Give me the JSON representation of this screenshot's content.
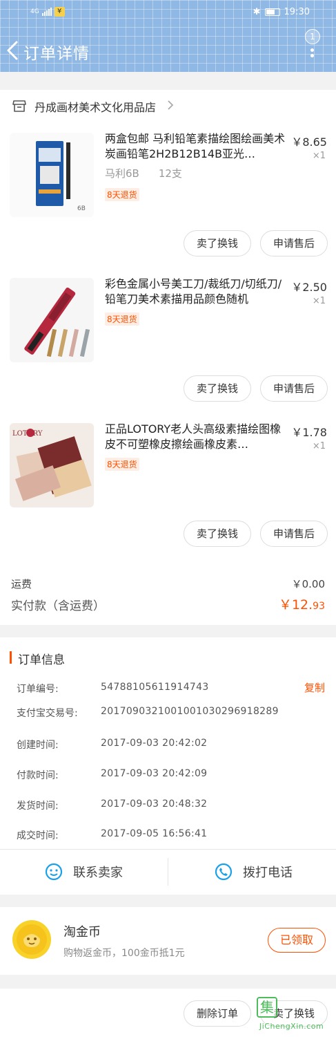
{
  "status_bar": {
    "network": "4G",
    "sim": "¥",
    "time": "19:30"
  },
  "header": {
    "title": "订单详情",
    "more_badge": "1"
  },
  "shop": {
    "name": "丹成画材美术文化用品店"
  },
  "items": [
    {
      "title": "两盒包邮 马利铅笔素描绘图绘画美术炭画铅笔2H2B12B14B亚光…",
      "price": "￥8.65",
      "qty": "×1",
      "sku": "马利6B",
      "sku2": "12支",
      "tag": "8天退货",
      "btn_sell": "卖了换钱",
      "btn_after": "申请售后"
    },
    {
      "title": "彩色金属小号美工刀/裁纸刀/切纸刀/铅笔刀美术素描用品颜色随机",
      "price": "￥2.50",
      "qty": "×1",
      "tag": "8天退货",
      "btn_sell": "卖了换钱",
      "btn_after": "申请售后"
    },
    {
      "title": "正品LOTORY老人头高级素描绘图橡皮不可塑橡皮擦绘画橡皮素…",
      "price": "￥1.78",
      "qty": "×1",
      "tag": "8天退货",
      "btn_sell": "卖了换钱",
      "btn_after": "申请售后",
      "thumb_logo": "LOTORY"
    }
  ],
  "totals": {
    "shipping_label": "运费",
    "shipping_value": "￥0.00",
    "paid_label": "实付款（含运费）",
    "paid_main": "￥12.",
    "paid_cents": "93"
  },
  "order_info": {
    "title": "订单信息",
    "copy_label": "复制",
    "rows": [
      {
        "label": "订单编号:",
        "value": "54788105611914743"
      },
      {
        "label": "支付宝交易号:",
        "value": "2017090321001001030296918289"
      },
      {
        "label": "创建时间:",
        "value": "2017-09-03 20:42:02"
      },
      {
        "label": "付款时间:",
        "value": "2017-09-03 20:42:09"
      },
      {
        "label": "发货时间:",
        "value": "2017-09-03 20:48:32"
      },
      {
        "label": "成交时间:",
        "value": "2017-09-05 16:56:41"
      }
    ],
    "contact_seller": "联系卖家",
    "call_phone": "拨打电话"
  },
  "coin": {
    "title": "淘金币",
    "subtitle": "购物返金币，100金币抵1元",
    "button": "已领取"
  },
  "bottom": {
    "delete": "删除订单",
    "sell": "卖了换钱",
    "watermark_char": "集",
    "watermark_text": "JiChengXin.com"
  },
  "colors": {
    "header_bg": "#90b8e4",
    "accent": "#ff5000"
  }
}
